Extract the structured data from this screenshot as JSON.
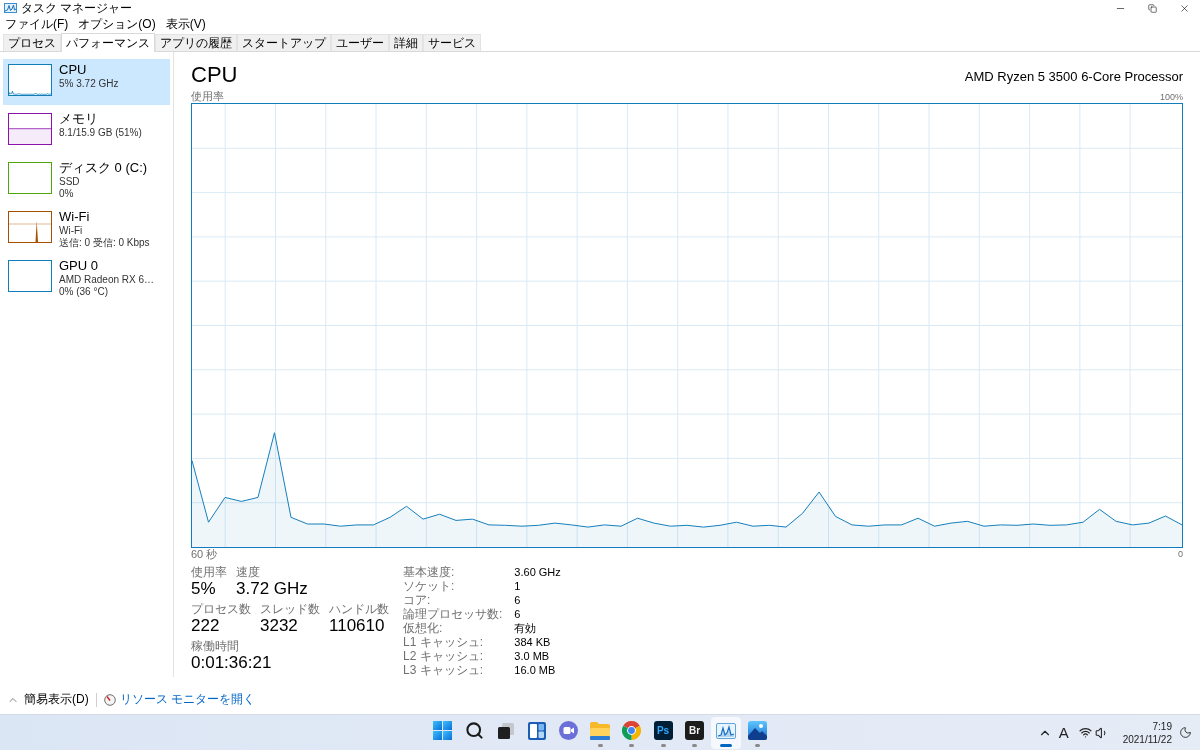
{
  "window": {
    "title": "タスク マネージャー"
  },
  "menu": [
    "ファイル(F)",
    "オプション(O)",
    "表示(V)"
  ],
  "tabs": [
    {
      "label": "プロセス",
      "selected": false
    },
    {
      "label": "パフォーマンス",
      "selected": true
    },
    {
      "label": "アプリの履歴",
      "selected": false
    },
    {
      "label": "スタートアップ",
      "selected": false
    },
    {
      "label": "ユーザー",
      "selected": false
    },
    {
      "label": "詳細",
      "selected": false
    },
    {
      "label": "サービス",
      "selected": false
    }
  ],
  "sidebar": {
    "items": [
      {
        "kind": "cpu",
        "title": "CPU",
        "details": [
          "5% 3.72 GHz"
        ],
        "color": "#117dbb",
        "selected": true
      },
      {
        "kind": "memory",
        "title": "メモリ",
        "details": [
          "8.1/15.9 GB (51%)"
        ],
        "color": "#8b12ae",
        "selected": false
      },
      {
        "kind": "disk",
        "title": "ディスク 0 (C:)",
        "details": [
          "SSD",
          "0%"
        ],
        "color": "#4da60c",
        "selected": false
      },
      {
        "kind": "network",
        "title": "Wi-Fi",
        "details": [
          "Wi-Fi",
          "送信: 0 受信: 0 Kbps"
        ],
        "color": "#a74f01",
        "selected": false
      },
      {
        "kind": "gpu",
        "title": "GPU 0",
        "details": [
          "AMD Radeon RX 6…",
          "0% (36 °C)"
        ],
        "color": "#117dbb",
        "selected": false
      }
    ]
  },
  "detail": {
    "title": "CPU",
    "model": "AMD Ryzen 5 3500 6-Core Processor",
    "graph": {
      "ylabel": "使用率",
      "ymax": "100%",
      "xstart": "60 秒",
      "xend": "0"
    },
    "stat_groups": [
      {
        "items": [
          {
            "label": "使用率",
            "value": "5%"
          },
          {
            "label": "速度",
            "value": "3.72 GHz"
          }
        ]
      },
      {
        "items": [
          {
            "label": "プロセス数",
            "value": "222"
          },
          {
            "label": "スレッド数",
            "value": "3232"
          },
          {
            "label": "ハンドル数",
            "value": "110610"
          }
        ]
      },
      {
        "items": [
          {
            "label": "稼働時間",
            "value": "0:01:36:21"
          }
        ]
      }
    ],
    "specs": [
      {
        "label": "基本速度:",
        "value": "3.60 GHz"
      },
      {
        "label": "ソケット:",
        "value": "1"
      },
      {
        "label": "コア:",
        "value": "6"
      },
      {
        "label": "論理プロセッサ数:",
        "value": "6"
      },
      {
        "label": "仮想化:",
        "value": "有効"
      },
      {
        "label": "L1 キャッシュ:",
        "value": "384 KB"
      },
      {
        "label": "L2 キャッシュ:",
        "value": "3.0 MB"
      },
      {
        "label": "L3 キャッシュ:",
        "value": "16.0 MB"
      }
    ]
  },
  "footer": {
    "toggle": "簡易表示(D)",
    "link": "リソース モニターを開く"
  },
  "taskbar": {
    "apps": [
      {
        "kind": "start",
        "running": false,
        "selected": false
      },
      {
        "kind": "search",
        "running": false,
        "selected": false
      },
      {
        "kind": "task_view",
        "running": false,
        "selected": false
      },
      {
        "kind": "widgets",
        "running": false,
        "selected": false
      },
      {
        "kind": "chat",
        "running": false,
        "selected": false
      },
      {
        "kind": "folder",
        "running": true,
        "selected": false
      },
      {
        "kind": "browser",
        "running": true,
        "selected": false
      },
      {
        "kind": "ps",
        "label": "Ps",
        "running": true,
        "selected": false
      },
      {
        "kind": "br",
        "label": "Br",
        "running": true,
        "selected": false
      },
      {
        "kind": "monitor",
        "running": true,
        "selected": true
      },
      {
        "kind": "photos",
        "running": true,
        "selected": false
      }
    ],
    "tray": {
      "ime": "A",
      "time": "7:19",
      "date": "2021/11/22"
    }
  }
}
